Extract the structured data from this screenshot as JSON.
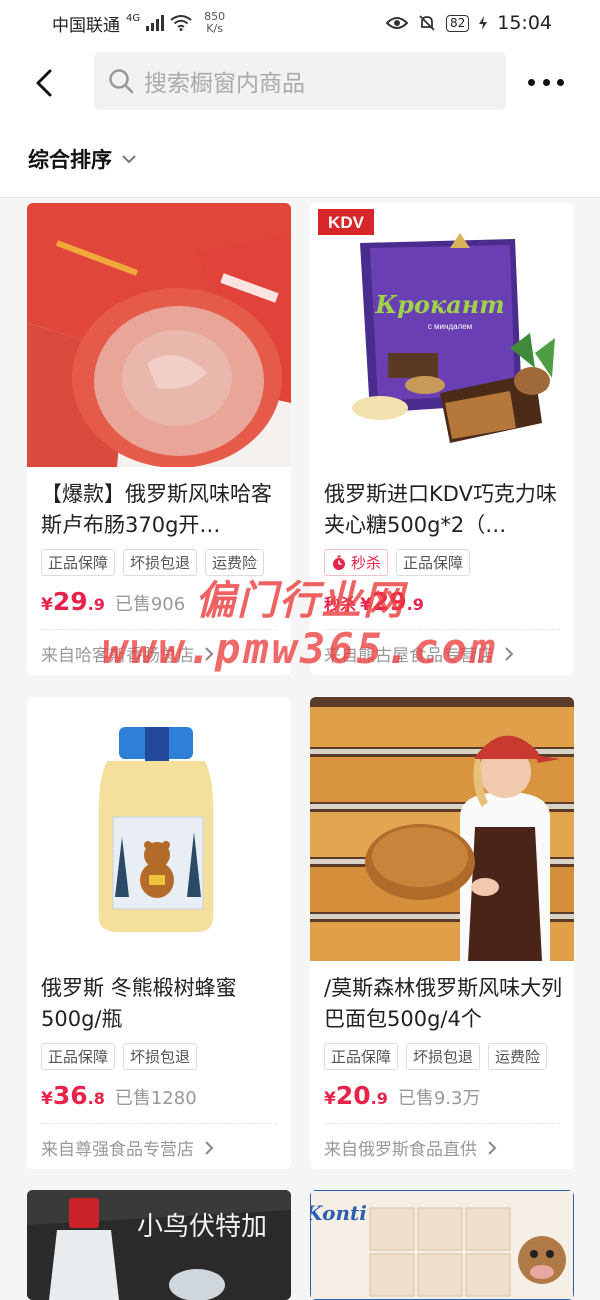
{
  "status": {
    "carrier": "中国联通",
    "signal_type": "4G",
    "net_speed_value": "850",
    "net_speed_unit": "K/s",
    "battery": "82",
    "time": "15:04"
  },
  "header": {
    "search_placeholder": "搜索橱窗内商品"
  },
  "sort": {
    "label": "综合排序"
  },
  "products": [
    {
      "title": "【爆款】俄罗斯风味哈客斯卢布肠370g开…",
      "tags": [
        "正品保障",
        "坏损包退",
        "运费险"
      ],
      "price_currency": "¥",
      "price_int": "29",
      "price_dec": ".9",
      "sold": "已售906",
      "store": "来自哈客斯香肠总店"
    },
    {
      "title": "俄罗斯进口KDV巧克力味夹心糖500g*2（…",
      "flash_tag": "秒杀",
      "tags": [
        "正品保障"
      ],
      "flash_label": "秒杀",
      "price_currency": "¥",
      "price_int": "29",
      "price_dec": ".9",
      "store": "来自熊古屋食品专营店",
      "image_text": {
        "brand": "KDV",
        "product": "Крокант",
        "sub": "с миндалем"
      }
    },
    {
      "title": "俄罗斯 冬熊椴树蜂蜜500g/瓶",
      "tags": [
        "正品保障",
        "坏损包退"
      ],
      "price_currency": "¥",
      "price_int": "36",
      "price_dec": ".8",
      "sold": "已售1280",
      "store": "来自尊强食品专营店"
    },
    {
      "title": "/莫斯森林俄罗斯风味大列巴面包500g/4个",
      "tags": [
        "正品保障",
        "坏损包退",
        "运费险"
      ],
      "price_currency": "¥",
      "price_int": "20",
      "price_dec": ".9",
      "sold": "已售9.3万",
      "store": "来自俄罗斯食品直供"
    },
    {
      "image_text": {
        "text": "小鸟伏特加"
      }
    },
    {
      "image_text": {
        "brand": "Konti"
      }
    }
  ],
  "watermark": {
    "line1": "偏门行业网",
    "line2": "www.pmw365.com"
  }
}
